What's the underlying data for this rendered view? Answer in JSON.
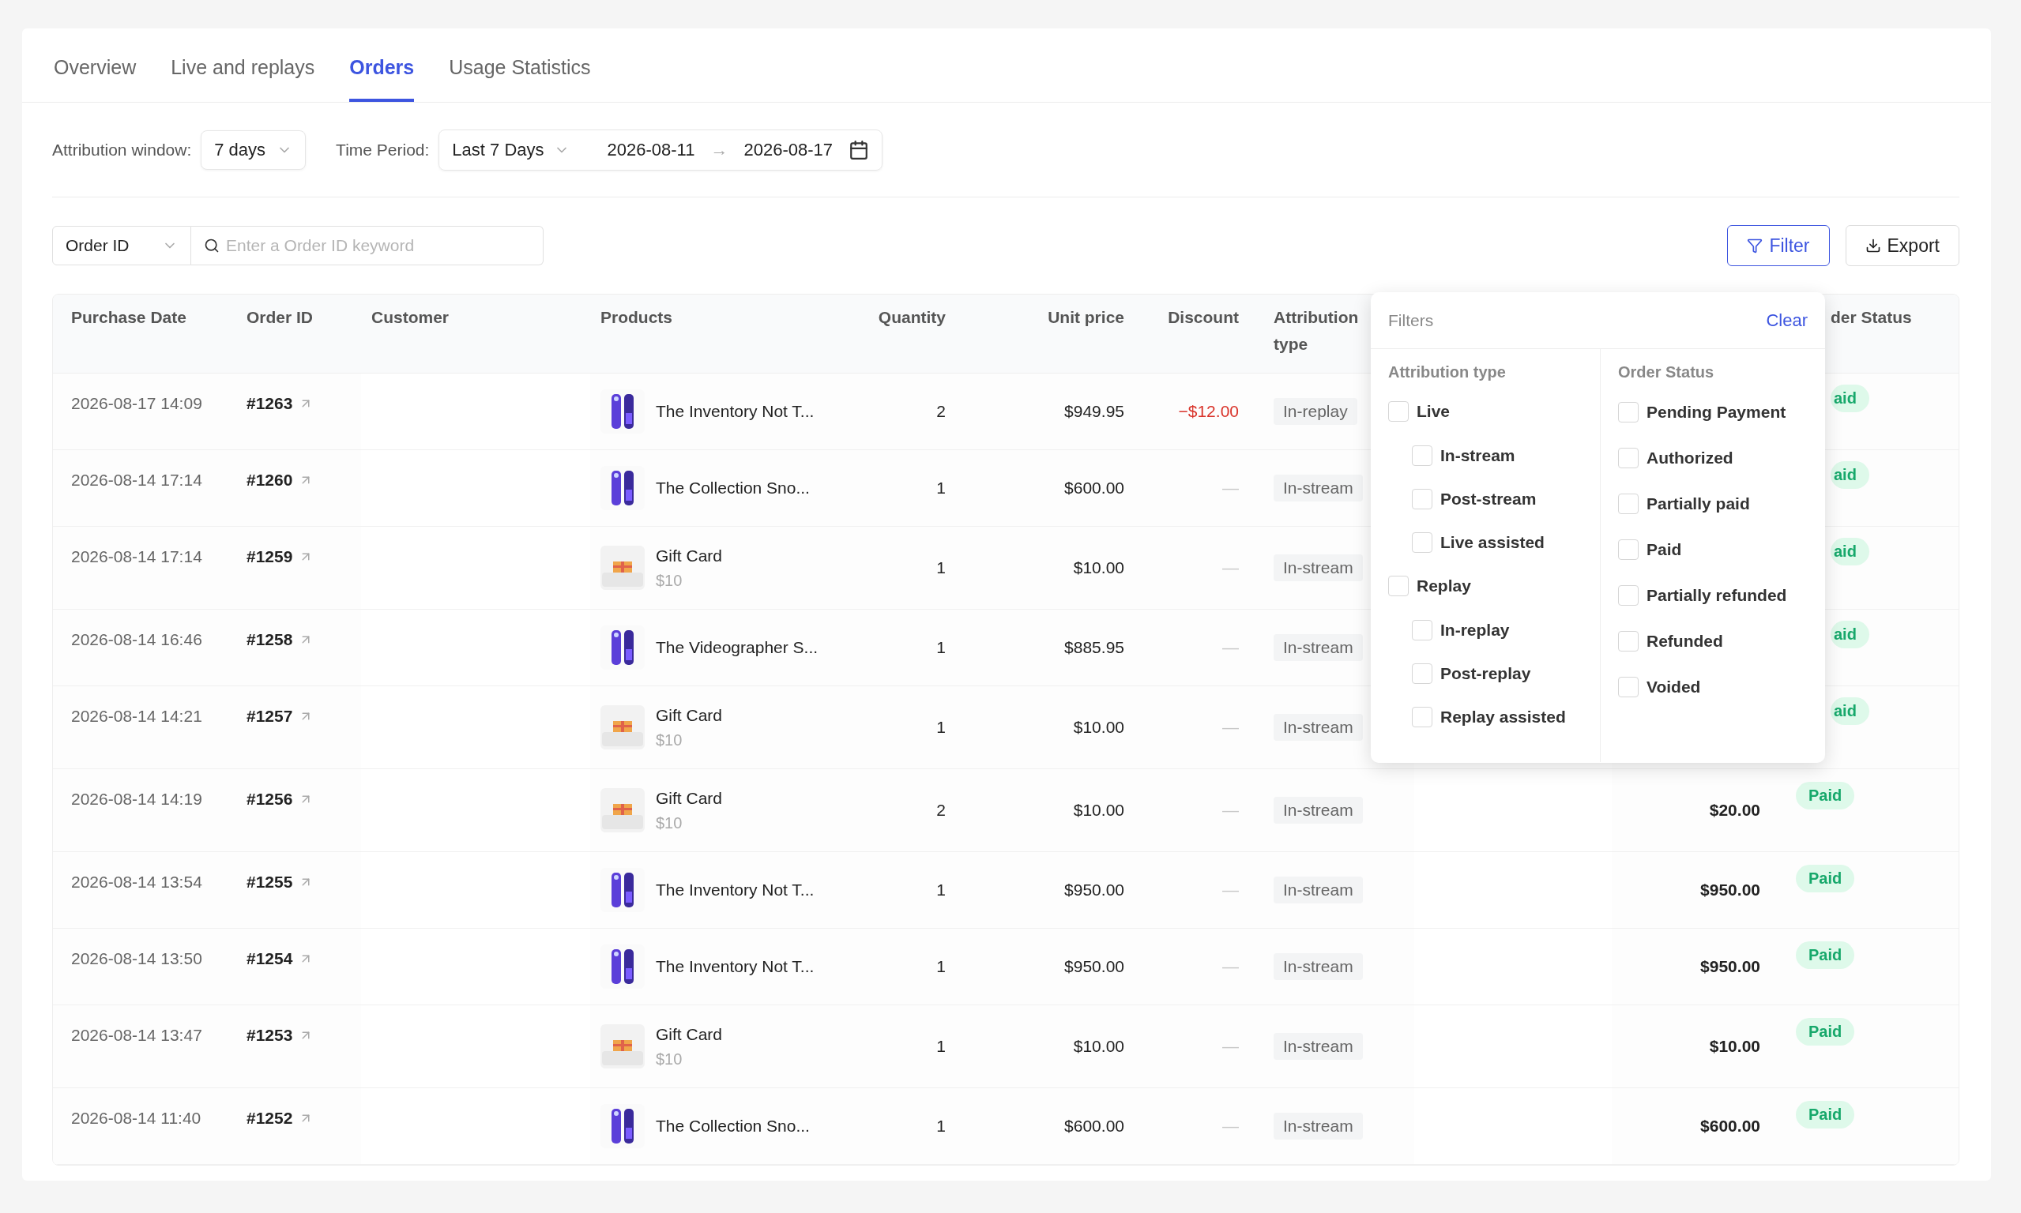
{
  "tabs": [
    {
      "label": "Overview",
      "selected": false
    },
    {
      "label": "Live and replays",
      "selected": false
    },
    {
      "label": "Orders",
      "selected": true
    },
    {
      "label": "Usage Statistics",
      "selected": false
    }
  ],
  "attribution_window": {
    "label": "Attribution window:",
    "value": "7 days"
  },
  "time_period": {
    "label": "Time Period:",
    "preset": "Last 7 Days",
    "start": "2026-08-11",
    "separator": "→",
    "end": "2026-08-17"
  },
  "search": {
    "field": "Order ID",
    "placeholder": "Enter a Order ID keyword"
  },
  "buttons": {
    "filter": "Filter",
    "export": "Export"
  },
  "table": {
    "columns": [
      "Purchase Date",
      "Order ID",
      "Customer",
      "Products",
      "Quantity",
      "Unit price",
      "Discount",
      "Attribution type",
      "der Status"
    ],
    "rows": [
      {
        "date": "2026-08-17 14:09",
        "order_id": "#1263",
        "product": "The Inventory Not T...",
        "quantity": "2",
        "unit_price": "$949.95",
        "discount": {
          "text": "−$12.00",
          "kind": "amount"
        },
        "attribution": "In-replay",
        "status": "aid"
      },
      {
        "date": "2026-08-14 17:14",
        "order_id": "#1260",
        "product": "The Collection Sno...",
        "quantity": "1",
        "unit_price": "$600.00",
        "discount": {
          "text": "—",
          "kind": "none"
        },
        "attribution": "In-stream",
        "status": "aid"
      },
      {
        "date": "2026-08-14 17:14",
        "order_id": "#1259",
        "product": "Gift Card",
        "subtitle": "$10",
        "quantity": "1",
        "unit_price": "$10.00",
        "discount": {
          "text": "—",
          "kind": "none"
        },
        "attribution": "In-stream",
        "status": "aid"
      },
      {
        "date": "2026-08-14 16:46",
        "order_id": "#1258",
        "product": "The Videographer S...",
        "quantity": "1",
        "unit_price": "$885.95",
        "discount": {
          "text": "—",
          "kind": "none"
        },
        "attribution": "In-stream",
        "status": "aid"
      },
      {
        "date": "2026-08-14 14:21",
        "order_id": "#1257",
        "product": "Gift Card",
        "subtitle": "$10",
        "quantity": "1",
        "unit_price": "$10.00",
        "discount": {
          "text": "—",
          "kind": "none"
        },
        "attribution": "In-stream",
        "status": "aid"
      },
      {
        "date": "2026-08-14 14:19",
        "order_id": "#1256",
        "product": "Gift Card",
        "subtitle": "$10",
        "quantity": "2",
        "unit_price": "$10.00",
        "discount": {
          "text": "—",
          "kind": "none"
        },
        "attribution": "In-stream",
        "total": "$20.00",
        "status": "Paid"
      },
      {
        "date": "2026-08-14 13:54",
        "order_id": "#1255",
        "product": "The Inventory Not T...",
        "quantity": "1",
        "unit_price": "$950.00",
        "discount": {
          "text": "—",
          "kind": "none"
        },
        "attribution": "In-stream",
        "total": "$950.00",
        "status": "Paid"
      },
      {
        "date": "2026-08-14 13:50",
        "order_id": "#1254",
        "product": "The Inventory Not T...",
        "quantity": "1",
        "unit_price": "$950.00",
        "discount": {
          "text": "—",
          "kind": "none"
        },
        "attribution": "In-stream",
        "total": "$950.00",
        "status": "Paid"
      },
      {
        "date": "2026-08-14 13:47",
        "order_id": "#1253",
        "product": "Gift Card",
        "subtitle": "$10",
        "quantity": "1",
        "unit_price": "$10.00",
        "discount": {
          "text": "—",
          "kind": "none"
        },
        "attribution": "In-stream",
        "total": "$10.00",
        "status": "Paid"
      },
      {
        "date": "2026-08-14 11:40",
        "order_id": "#1252",
        "product": "The Collection Sno...",
        "quantity": "1",
        "unit_price": "$600.00",
        "discount": {
          "text": "—",
          "kind": "none"
        },
        "attribution": "In-stream",
        "total": "$600.00",
        "status": "Paid"
      }
    ]
  },
  "filters_popup": {
    "title": "Filters",
    "clear": "Clear",
    "groups": [
      {
        "title": "Attribution type",
        "options": [
          {
            "label": "Live",
            "checked": false,
            "children": [
              {
                "label": "In-stream",
                "checked": false
              },
              {
                "label": "Post-stream",
                "checked": false
              },
              {
                "label": "Live assisted",
                "checked": false
              }
            ]
          },
          {
            "label": "Replay",
            "checked": false,
            "children": [
              {
                "label": "In-replay",
                "checked": false
              },
              {
                "label": "Post-replay",
                "checked": false
              },
              {
                "label": "Replay assisted",
                "checked": false
              }
            ]
          }
        ]
      },
      {
        "title": "Order Status",
        "options": [
          {
            "label": "Pending Payment",
            "checked": false
          },
          {
            "label": "Authorized",
            "checked": false
          },
          {
            "label": "Partially paid",
            "checked": false
          },
          {
            "label": "Paid",
            "checked": false
          },
          {
            "label": "Partially refunded",
            "checked": false
          },
          {
            "label": "Refunded",
            "checked": false
          },
          {
            "label": "Voided",
            "checked": false
          }
        ]
      }
    ]
  }
}
